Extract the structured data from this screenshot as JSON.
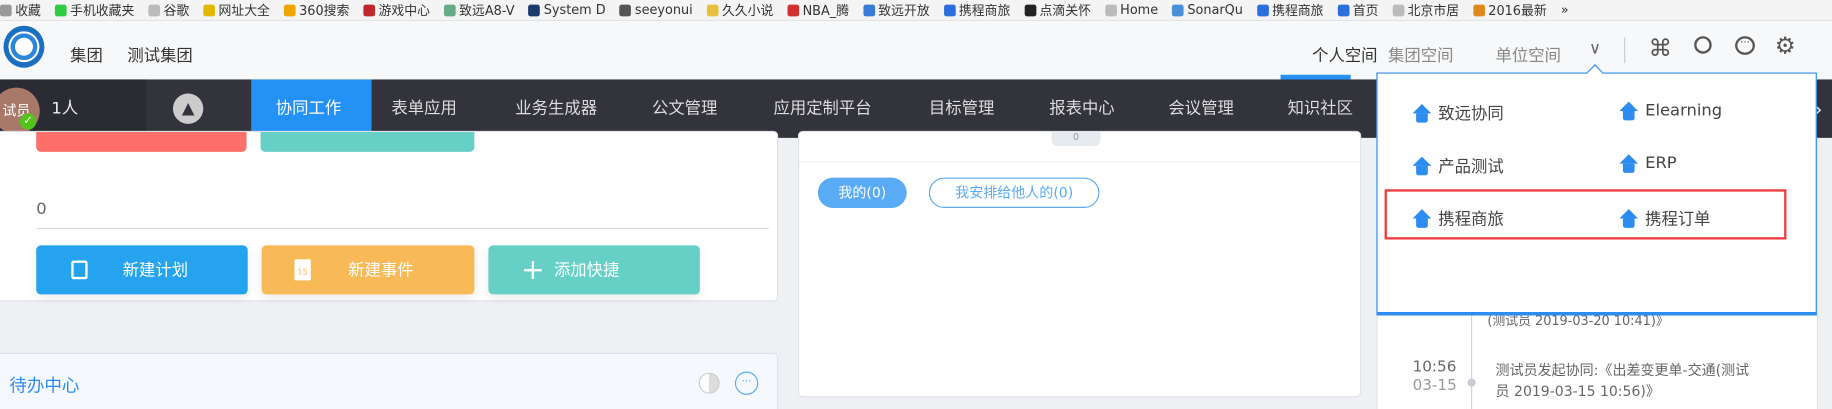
{
  "bookmarks": [
    {
      "label": "收藏",
      "color": "#999"
    },
    {
      "label": "手机收藏夹",
      "color": "#2ecc40"
    },
    {
      "label": "谷歌",
      "color": "#bbb"
    },
    {
      "label": "网址大全",
      "color": "#e5b800"
    },
    {
      "label": "360搜索",
      "color": "#f0a500"
    },
    {
      "label": "游戏中心",
      "color": "#c0282d"
    },
    {
      "label": "致远A8-V",
      "color": "#6a8"
    },
    {
      "label": "System D",
      "color": "#1b3b6f"
    },
    {
      "label": "seeyonui",
      "color": "#555"
    },
    {
      "label": "久久小说",
      "color": "#e8c040"
    },
    {
      "label": "NBA_腾",
      "color": "#d03030"
    },
    {
      "label": "致远开放",
      "color": "#3a7bd5"
    },
    {
      "label": "携程商旅",
      "color": "#2a6fdb"
    },
    {
      "label": "点滴关怀",
      "color": "#222"
    },
    {
      "label": "Home",
      "color": "#bbb"
    },
    {
      "label": "SonarQu",
      "color": "#4a90d9"
    },
    {
      "label": "携程商旅",
      "color": "#2a6fdb"
    },
    {
      "label": "首页",
      "color": "#2a6fdb"
    },
    {
      "label": "北京市居",
      "color": "#bbb"
    },
    {
      "label": "2016最新",
      "color": "#e08a1e"
    }
  ],
  "bookmarks_more": "»",
  "header": {
    "group_label": "集团",
    "group_name": "测试集团",
    "spaces": [
      "个人空间",
      "集团空间",
      "单位空间"
    ],
    "active_space": "个人空间"
  },
  "user": {
    "avatar_text": "试员",
    "count_label": "1人"
  },
  "nav": {
    "items": [
      "协同工作",
      "表单应用",
      "业务生成器",
      "公文管理",
      "应用定制平台",
      "目标管理",
      "报表中心",
      "会议管理",
      "知识社区"
    ],
    "active": "协同工作",
    "more": "›"
  },
  "left_card": {
    "count": "0",
    "buttons": [
      "新建计划",
      "新建事件",
      "添加快捷"
    ],
    "calendar_day": "15"
  },
  "todo": {
    "title": "待办中心"
  },
  "middle": {
    "tab_count": "0",
    "filters": [
      "我的(0)",
      "我安排给他人的(0)"
    ]
  },
  "dropdown": {
    "items": [
      "致远协同",
      "Elearning",
      "产品测试",
      "ERP",
      "携程商旅",
      "携程订单"
    ],
    "highlight_color": "#f03c3c"
  },
  "timeline": {
    "partial_text": "(测试员 2019-03-20 10:41)》",
    "items": [
      {
        "time": "10:56",
        "date": "03-15",
        "text_line1": "测试员发起协同:《出差变更单-交通(测试",
        "text_line2": "员 2019-03-15 10:56)》"
      }
    ]
  },
  "colors": {
    "accent": "#2491f7",
    "nav_bg": "#32333b",
    "red": "#fe6f6a",
    "teal": "#66d0c6",
    "blue_btn": "#26a3ee",
    "orange": "#f8ba57"
  }
}
